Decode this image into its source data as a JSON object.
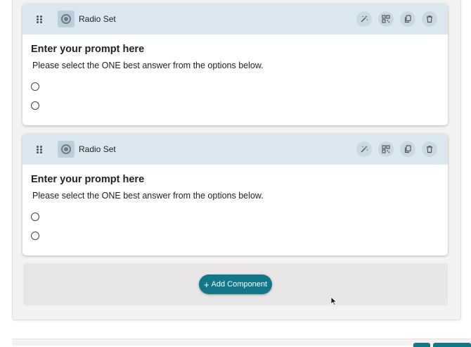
{
  "components": [
    {
      "type_label": "Radio Set",
      "type_icon": "radio-button-icon",
      "prompt": "Enter your prompt here",
      "instruction": "Please select the ONE best answer from the options below.",
      "options": [
        "",
        ""
      ],
      "tools": [
        "magic-wand-icon",
        "qr-code-icon",
        "copy-icon",
        "trash-icon"
      ]
    },
    {
      "type_label": "Radio Set",
      "type_icon": "radio-button-icon",
      "prompt": "Enter your prompt here",
      "instruction": "Please select the ONE best answer from the options below.",
      "options": [
        "",
        ""
      ],
      "tools": [
        "magic-wand-icon",
        "qr-code-icon",
        "copy-icon",
        "trash-icon"
      ]
    }
  ],
  "add_component": {
    "label": "Add Component",
    "icon": "plus-icon"
  },
  "colors": {
    "header_bg": "#dbe8f0",
    "primary_button": "#127889",
    "panel_bg": "#f3f2f0"
  }
}
